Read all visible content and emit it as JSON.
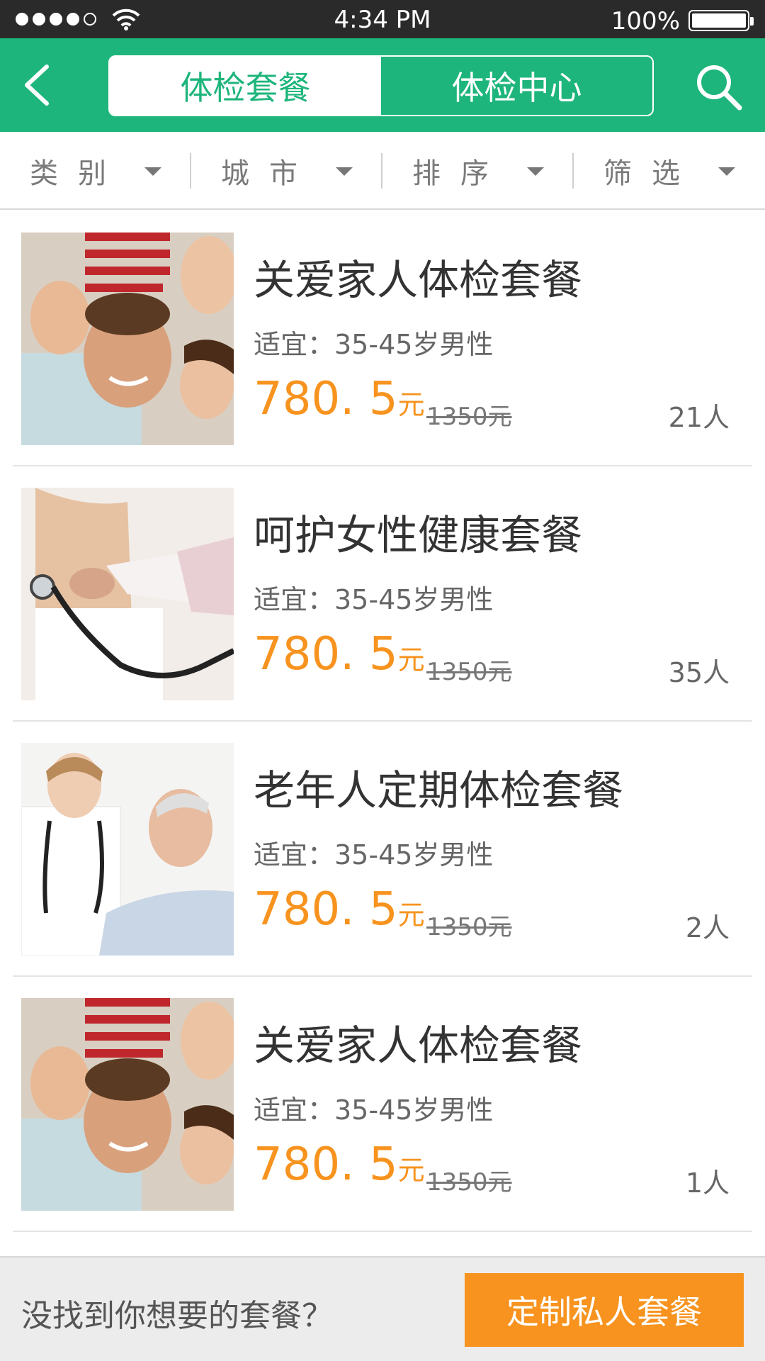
{
  "status_bar": {
    "time": "4:34 PM",
    "battery": "100%"
  },
  "nav": {
    "tabs": [
      {
        "label": "体检套餐",
        "active": true
      },
      {
        "label": "体检中心",
        "active": false
      }
    ],
    "back_icon": "chevron-left-icon",
    "search_icon": "search-icon"
  },
  "filters": [
    {
      "label": "类别"
    },
    {
      "label": "城市"
    },
    {
      "label": "排序"
    },
    {
      "label": "筛选"
    }
  ],
  "packages": [
    {
      "title": "关爱家人体检套餐",
      "suit": "适宜：35-45岁男性",
      "price": "780. 5",
      "unit": "元",
      "old_price": "1350元",
      "count": "21人",
      "image": "family-photo"
    },
    {
      "title": "呵护女性健康套餐",
      "suit": "适宜：35-45岁男性",
      "price": "780. 5",
      "unit": "元",
      "old_price": "1350元",
      "count": "35人",
      "image": "stethoscope-photo"
    },
    {
      "title": "老年人定期体检套餐",
      "suit": "适宜：35-45岁男性",
      "price": "780. 5",
      "unit": "元",
      "old_price": "1350元",
      "count": "2人",
      "image": "elderly-care-photo"
    },
    {
      "title": "关爱家人体检套餐",
      "suit": "适宜：35-45岁男性",
      "price": "780. 5",
      "unit": "元",
      "old_price": "1350元",
      "count": "1人",
      "image": "family-photo"
    }
  ],
  "bottom": {
    "prompt": "没找到你想要的套餐？",
    "button": "定制私人套餐"
  },
  "colors": {
    "brand_green": "#1db57b",
    "price_orange": "#f7931e"
  }
}
